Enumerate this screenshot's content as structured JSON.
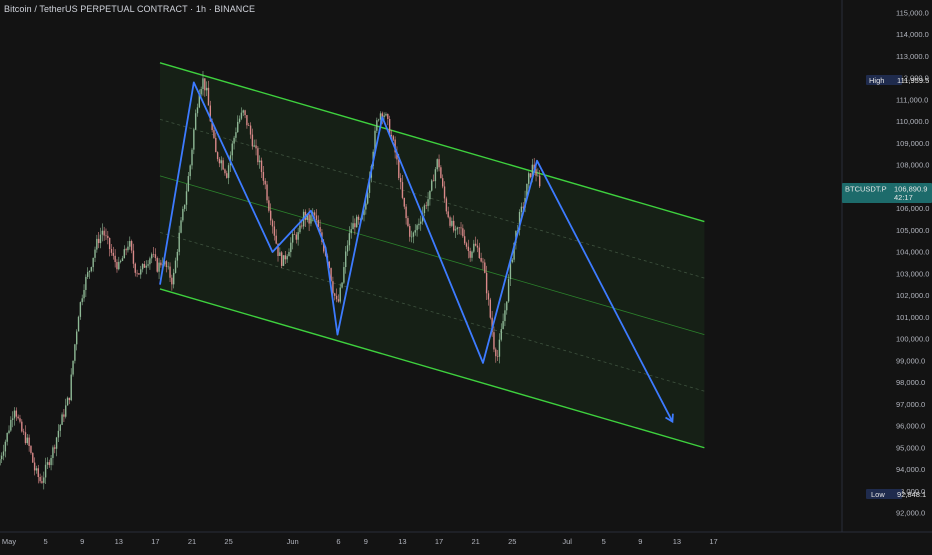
{
  "title": "Bitcoin / TetherUS PERPETUAL CONTRACT · 1h · BINANCE",
  "colors": {
    "background": "#131313",
    "candle_up": "#8fb996",
    "candle_down": "#d98989",
    "channel_line": "#3ed13e",
    "channel_fill": "#1e3a1e",
    "zigzag": "#3d7bff",
    "last_price_tag": "#1d6b6b",
    "high_low_tag": "#1f2b4d"
  },
  "price_scale": {
    "labels": [
      "115,000.0",
      "114,000.0",
      "113,000.0",
      "112,000.0",
      "111,000.0",
      "110,000.0",
      "109,000.0",
      "108,000.0",
      "106,000.0",
      "105,000.0",
      "104,000.0",
      "103,000.0",
      "102,000.0",
      "101,000.0",
      "100,000.0",
      "99,000.0",
      "98,000.0",
      "97,000.0",
      "96,000.0",
      "95,000.0",
      "94,000.0",
      "93,000.0",
      "92,000.0"
    ],
    "values": [
      115000,
      114000,
      113000,
      112000,
      111000,
      110000,
      109000,
      108000,
      106000,
      105000,
      104000,
      103000,
      102000,
      101000,
      100000,
      99000,
      98000,
      97000,
      96000,
      95000,
      94000,
      93000,
      92000
    ]
  },
  "time_scale": {
    "labels": [
      "May",
      "5",
      "9",
      "13",
      "17",
      "21",
      "25",
      "Jun",
      "6",
      "9",
      "13",
      "17",
      "21",
      "25",
      "Jul",
      "5",
      "9",
      "13",
      "17"
    ],
    "days": [
      1,
      5,
      9,
      13,
      17,
      21,
      25,
      32,
      37,
      40,
      44,
      48,
      52,
      56,
      62,
      66,
      70,
      74,
      78
    ]
  },
  "tags": {
    "high_label": "High",
    "high_value": "111,959.5",
    "symbol": "BTCUSDT.P",
    "last_price": "106,890.9",
    "countdown": "42:17",
    "low_label": "Low",
    "low_value": "92,848.1"
  },
  "chart_data": {
    "type": "candlestick",
    "symbol": "BTCUSDT.P",
    "interval": "1h",
    "x_unit": "days since Apr 30",
    "y_range": [
      91500,
      115500
    ],
    "high": 111959.5,
    "low": 92848.1,
    "last": 106890.9,
    "price_path": [
      [
        0.0,
        94200
      ],
      [
        1.0,
        95600
      ],
      [
        1.8,
        96900
      ],
      [
        2.5,
        95800
      ],
      [
        3.3,
        95200
      ],
      [
        4.0,
        94000
      ],
      [
        4.7,
        93400
      ],
      [
        5.3,
        94100
      ],
      [
        6.0,
        94900
      ],
      [
        6.6,
        95800
      ],
      [
        7.2,
        96600
      ],
      [
        7.8,
        97400
      ],
      [
        8.3,
        99400
      ],
      [
        8.8,
        101200
      ],
      [
        9.4,
        102500
      ],
      [
        10.0,
        103200
      ],
      [
        10.7,
        104300
      ],
      [
        11.4,
        105000
      ],
      [
        12.0,
        104400
      ],
      [
        12.6,
        103700
      ],
      [
        13.2,
        103300
      ],
      [
        13.8,
        103900
      ],
      [
        14.3,
        104500
      ],
      [
        14.9,
        103300
      ],
      [
        15.5,
        103000
      ],
      [
        16.1,
        103500
      ],
      [
        16.8,
        103900
      ],
      [
        17.4,
        103300
      ],
      [
        18.0,
        103600
      ],
      [
        18.6,
        103100
      ],
      [
        19.1,
        102600
      ],
      [
        19.7,
        104500
      ],
      [
        20.4,
        106300
      ],
      [
        21.0,
        108000
      ],
      [
        21.5,
        110000
      ],
      [
        22.0,
        111500
      ],
      [
        22.4,
        111900
      ],
      [
        22.8,
        111300
      ],
      [
        23.3,
        109800
      ],
      [
        23.8,
        108500
      ],
      [
        24.4,
        108200
      ],
      [
        25.0,
        107600
      ],
      [
        25.6,
        108900
      ],
      [
        26.2,
        110000
      ],
      [
        26.8,
        110400
      ],
      [
        27.4,
        109700
      ],
      [
        28.0,
        108800
      ],
      [
        28.6,
        108000
      ],
      [
        29.1,
        107300
      ],
      [
        29.6,
        106100
      ],
      [
        30.1,
        105100
      ],
      [
        30.6,
        104000
      ],
      [
        31.1,
        103500
      ],
      [
        31.7,
        104100
      ],
      [
        32.3,
        104700
      ],
      [
        32.9,
        104800
      ],
      [
        33.4,
        105700
      ],
      [
        34.0,
        105400
      ],
      [
        34.5,
        105800
      ],
      [
        35.1,
        104900
      ],
      [
        35.6,
        104200
      ],
      [
        36.1,
        103600
      ],
      [
        36.6,
        102300
      ],
      [
        37.1,
        101500
      ],
      [
        37.6,
        102600
      ],
      [
        38.1,
        104200
      ],
      [
        38.6,
        105100
      ],
      [
        39.1,
        105400
      ],
      [
        39.6,
        105300
      ],
      [
        40.1,
        105900
      ],
      [
        40.6,
        107600
      ],
      [
        41.1,
        109100
      ],
      [
        41.5,
        110200
      ],
      [
        41.9,
        110500
      ],
      [
        42.3,
        110300
      ],
      [
        42.8,
        109600
      ],
      [
        43.3,
        108800
      ],
      [
        43.7,
        107900
      ],
      [
        44.2,
        106400
      ],
      [
        44.7,
        105300
      ],
      [
        45.2,
        104600
      ],
      [
        45.7,
        105100
      ],
      [
        46.2,
        105600
      ],
      [
        46.7,
        106200
      ],
      [
        47.2,
        106600
      ],
      [
        47.6,
        107500
      ],
      [
        48.1,
        108300
      ],
      [
        48.5,
        107100
      ],
      [
        49.0,
        106000
      ],
      [
        49.5,
        105300
      ],
      [
        50.0,
        104800
      ],
      [
        50.5,
        105100
      ],
      [
        51.0,
        104600
      ],
      [
        51.5,
        103900
      ],
      [
        52.0,
        104300
      ],
      [
        52.5,
        104100
      ],
      [
        53.0,
        103400
      ],
      [
        53.4,
        102300
      ],
      [
        53.8,
        101000
      ],
      [
        54.2,
        99700
      ],
      [
        54.6,
        99200
      ],
      [
        55.0,
        100300
      ],
      [
        55.5,
        101600
      ],
      [
        56.0,
        103300
      ],
      [
        56.5,
        104700
      ],
      [
        57.0,
        105600
      ],
      [
        57.5,
        106300
      ],
      [
        58.0,
        107400
      ],
      [
        58.5,
        108000
      ],
      [
        58.9,
        107500
      ],
      [
        59.2,
        106900
      ]
    ],
    "channel": {
      "upper": [
        [
          17.5,
          112700
        ],
        [
          77.0,
          105400
        ]
      ],
      "lower": [
        [
          17.5,
          102300
        ],
        [
          77.0,
          95000
        ]
      ],
      "mid_lines": [
        [
          [
            17.5,
            107500
          ],
          [
            77.0,
            100200
          ]
        ],
        [
          [
            17.5,
            110100
          ],
          [
            77.0,
            102800
          ]
        ],
        [
          [
            17.5,
            104900
          ],
          [
            77.0,
            97600
          ]
        ]
      ]
    },
    "zigzag": [
      [
        17.5,
        102500
      ],
      [
        21.2,
        111800
      ],
      [
        29.8,
        104000
      ],
      [
        34.0,
        105900
      ],
      [
        35.6,
        104200
      ],
      [
        36.9,
        100200
      ],
      [
        41.8,
        110200
      ],
      [
        52.8,
        98900
      ],
      [
        58.7,
        108200
      ],
      [
        73.5,
        96200
      ]
    ]
  }
}
